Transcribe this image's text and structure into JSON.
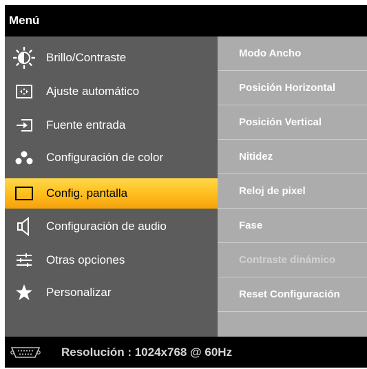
{
  "menu": {
    "title": "Menú",
    "items": [
      {
        "label": "Brillo/Contraste",
        "icon": "brightness-icon"
      },
      {
        "label": "Ajuste automático",
        "icon": "auto-adjust-icon"
      },
      {
        "label": "Fuente entrada",
        "icon": "input-source-icon"
      },
      {
        "label": "Configuración de color",
        "icon": "color-dots-icon"
      },
      {
        "label": "Config. pantalla",
        "icon": "display-icon",
        "selected": true
      },
      {
        "label": "Configuración de audio",
        "icon": "speaker-icon"
      },
      {
        "label": "Otras opciones",
        "icon": "sliders-icon"
      },
      {
        "label": "Personalizar",
        "icon": "star-icon"
      }
    ]
  },
  "submenu": {
    "items": [
      {
        "label": "Modo Ancho"
      },
      {
        "label": "Posición Horizontal"
      },
      {
        "label": "Posición Vertical"
      },
      {
        "label": "Nitidez"
      },
      {
        "label": "Reloj de pixel"
      },
      {
        "label": "Fase"
      },
      {
        "label": "Contraste dinámico",
        "disabled": true
      },
      {
        "label": "Reset Configuración"
      }
    ]
  },
  "footer": {
    "connector_icon": "vga-connector-icon",
    "resolution": "Resolución : 1024x768 @ 60Hz"
  },
  "colors": {
    "selected_highlight": "#ffc52a",
    "left_panel": "#5c5c5c",
    "right_panel": "#acacac"
  }
}
